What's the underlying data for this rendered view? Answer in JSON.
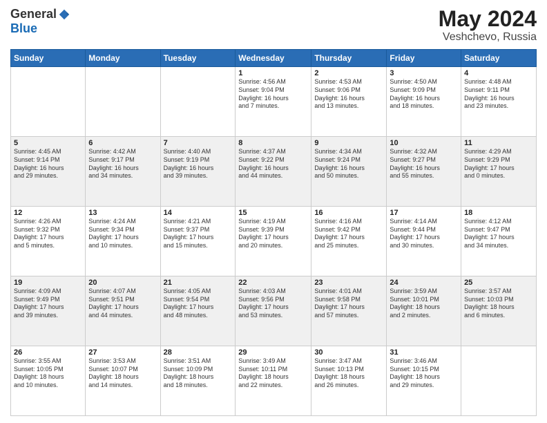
{
  "header": {
    "logo": {
      "general": "General",
      "blue": "Blue"
    },
    "title": "May 2024",
    "subtitle": "Veshchevo, Russia"
  },
  "days_of_week": [
    "Sunday",
    "Monday",
    "Tuesday",
    "Wednesday",
    "Thursday",
    "Friday",
    "Saturday"
  ],
  "weeks": [
    [
      {
        "day": "",
        "info": ""
      },
      {
        "day": "",
        "info": ""
      },
      {
        "day": "",
        "info": ""
      },
      {
        "day": "1",
        "info": "Sunrise: 4:56 AM\nSunset: 9:04 PM\nDaylight: 16 hours\nand 7 minutes."
      },
      {
        "day": "2",
        "info": "Sunrise: 4:53 AM\nSunset: 9:06 PM\nDaylight: 16 hours\nand 13 minutes."
      },
      {
        "day": "3",
        "info": "Sunrise: 4:50 AM\nSunset: 9:09 PM\nDaylight: 16 hours\nand 18 minutes."
      },
      {
        "day": "4",
        "info": "Sunrise: 4:48 AM\nSunset: 9:11 PM\nDaylight: 16 hours\nand 23 minutes."
      }
    ],
    [
      {
        "day": "5",
        "info": "Sunrise: 4:45 AM\nSunset: 9:14 PM\nDaylight: 16 hours\nand 29 minutes."
      },
      {
        "day": "6",
        "info": "Sunrise: 4:42 AM\nSunset: 9:17 PM\nDaylight: 16 hours\nand 34 minutes."
      },
      {
        "day": "7",
        "info": "Sunrise: 4:40 AM\nSunset: 9:19 PM\nDaylight: 16 hours\nand 39 minutes."
      },
      {
        "day": "8",
        "info": "Sunrise: 4:37 AM\nSunset: 9:22 PM\nDaylight: 16 hours\nand 44 minutes."
      },
      {
        "day": "9",
        "info": "Sunrise: 4:34 AM\nSunset: 9:24 PM\nDaylight: 16 hours\nand 50 minutes."
      },
      {
        "day": "10",
        "info": "Sunrise: 4:32 AM\nSunset: 9:27 PM\nDaylight: 16 hours\nand 55 minutes."
      },
      {
        "day": "11",
        "info": "Sunrise: 4:29 AM\nSunset: 9:29 PM\nDaylight: 17 hours\nand 0 minutes."
      }
    ],
    [
      {
        "day": "12",
        "info": "Sunrise: 4:26 AM\nSunset: 9:32 PM\nDaylight: 17 hours\nand 5 minutes."
      },
      {
        "day": "13",
        "info": "Sunrise: 4:24 AM\nSunset: 9:34 PM\nDaylight: 17 hours\nand 10 minutes."
      },
      {
        "day": "14",
        "info": "Sunrise: 4:21 AM\nSunset: 9:37 PM\nDaylight: 17 hours\nand 15 minutes."
      },
      {
        "day": "15",
        "info": "Sunrise: 4:19 AM\nSunset: 9:39 PM\nDaylight: 17 hours\nand 20 minutes."
      },
      {
        "day": "16",
        "info": "Sunrise: 4:16 AM\nSunset: 9:42 PM\nDaylight: 17 hours\nand 25 minutes."
      },
      {
        "day": "17",
        "info": "Sunrise: 4:14 AM\nSunset: 9:44 PM\nDaylight: 17 hours\nand 30 minutes."
      },
      {
        "day": "18",
        "info": "Sunrise: 4:12 AM\nSunset: 9:47 PM\nDaylight: 17 hours\nand 34 minutes."
      }
    ],
    [
      {
        "day": "19",
        "info": "Sunrise: 4:09 AM\nSunset: 9:49 PM\nDaylight: 17 hours\nand 39 minutes."
      },
      {
        "day": "20",
        "info": "Sunrise: 4:07 AM\nSunset: 9:51 PM\nDaylight: 17 hours\nand 44 minutes."
      },
      {
        "day": "21",
        "info": "Sunrise: 4:05 AM\nSunset: 9:54 PM\nDaylight: 17 hours\nand 48 minutes."
      },
      {
        "day": "22",
        "info": "Sunrise: 4:03 AM\nSunset: 9:56 PM\nDaylight: 17 hours\nand 53 minutes."
      },
      {
        "day": "23",
        "info": "Sunrise: 4:01 AM\nSunset: 9:58 PM\nDaylight: 17 hours\nand 57 minutes."
      },
      {
        "day": "24",
        "info": "Sunrise: 3:59 AM\nSunset: 10:01 PM\nDaylight: 18 hours\nand 2 minutes."
      },
      {
        "day": "25",
        "info": "Sunrise: 3:57 AM\nSunset: 10:03 PM\nDaylight: 18 hours\nand 6 minutes."
      }
    ],
    [
      {
        "day": "26",
        "info": "Sunrise: 3:55 AM\nSunset: 10:05 PM\nDaylight: 18 hours\nand 10 minutes."
      },
      {
        "day": "27",
        "info": "Sunrise: 3:53 AM\nSunset: 10:07 PM\nDaylight: 18 hours\nand 14 minutes."
      },
      {
        "day": "28",
        "info": "Sunrise: 3:51 AM\nSunset: 10:09 PM\nDaylight: 18 hours\nand 18 minutes."
      },
      {
        "day": "29",
        "info": "Sunrise: 3:49 AM\nSunset: 10:11 PM\nDaylight: 18 hours\nand 22 minutes."
      },
      {
        "day": "30",
        "info": "Sunrise: 3:47 AM\nSunset: 10:13 PM\nDaylight: 18 hours\nand 26 minutes."
      },
      {
        "day": "31",
        "info": "Sunrise: 3:46 AM\nSunset: 10:15 PM\nDaylight: 18 hours\nand 29 minutes."
      },
      {
        "day": "",
        "info": ""
      }
    ]
  ]
}
